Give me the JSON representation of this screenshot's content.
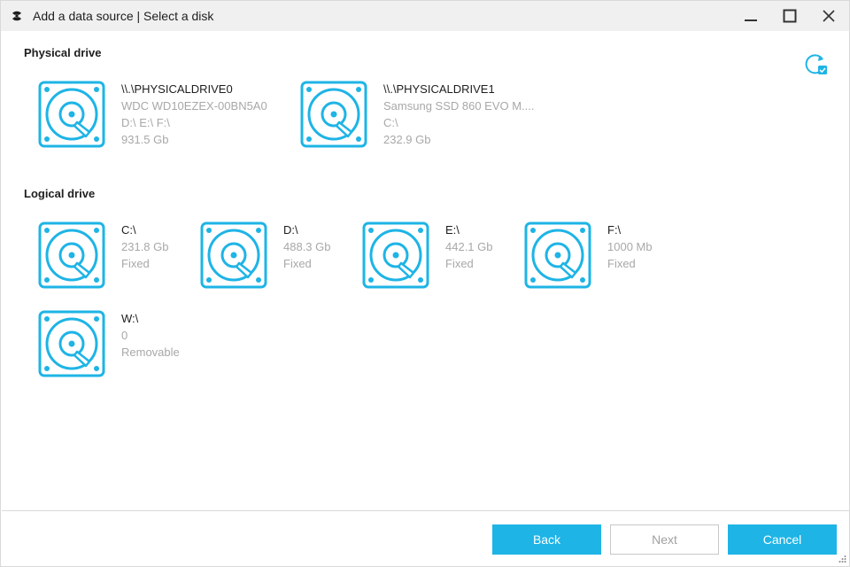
{
  "window": {
    "title": "Add a data source | Select a disk",
    "accent_color": "#1eb4e6"
  },
  "sections": {
    "physical_title": "Physical drive",
    "logical_title": "Logical drive"
  },
  "physical_drives": [
    {
      "name": "\\\\.\\PHYSICALDRIVE0",
      "model": "WDC WD10EZEX-00BN5A0",
      "partitions": "D:\\ E:\\ F:\\",
      "size": "931.5 Gb",
      "icon": "hard-drive-icon"
    },
    {
      "name": "\\\\.\\PHYSICALDRIVE1",
      "model": "Samsung SSD 860 EVO M....",
      "partitions": "C:\\",
      "size": "232.9 Gb",
      "icon": "hard-drive-icon"
    }
  ],
  "logical_drives": [
    {
      "name": "C:\\",
      "size": "231.8 Gb",
      "type": "Fixed",
      "icon": "hard-drive-icon"
    },
    {
      "name": "D:\\",
      "size": "488.3 Gb",
      "type": "Fixed",
      "icon": "hard-drive-icon"
    },
    {
      "name": "E:\\",
      "size": "442.1 Gb",
      "type": "Fixed",
      "icon": "hard-drive-icon"
    },
    {
      "name": "F:\\",
      "size": "1000 Mb",
      "type": "Fixed",
      "icon": "hard-drive-icon"
    },
    {
      "name": "W:\\",
      "size": "0",
      "type": "Removable",
      "icon": "hard-drive-icon"
    }
  ],
  "buttons": {
    "back": "Back",
    "next": "Next",
    "cancel": "Cancel"
  }
}
